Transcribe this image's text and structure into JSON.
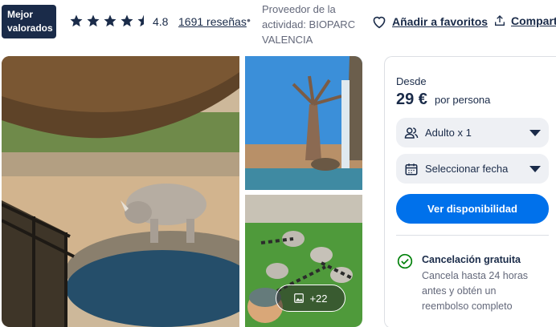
{
  "header": {
    "badge_line1": "Mejor",
    "badge_line2": "valorados",
    "rating": "4.8",
    "stars_filled": 4.5,
    "reviews": "1691 reseñas",
    "separator": "•",
    "provider_line1": "Proveedor de la",
    "provider_line2": "actividad: BIOPARC",
    "provider_line3": "VALENCIA",
    "favorites_label": "Añadir a favoritos",
    "share_label": "Compartir"
  },
  "gallery": {
    "more_label": "+22"
  },
  "booking": {
    "from_label": "Desde",
    "price": "29 €",
    "per_label": "por persona",
    "adults_label": "Adulto x 1",
    "date_label": "Seleccionar fecha",
    "availability_button": "Ver disponibilidad",
    "cancel_title": "Cancelación gratuita",
    "cancel_desc": "Cancela hasta 24 horas antes y obtén un reembolso completo"
  },
  "colors": {
    "navy": "#1a2b49",
    "primary": "#0071eb",
    "success": "#008009"
  }
}
